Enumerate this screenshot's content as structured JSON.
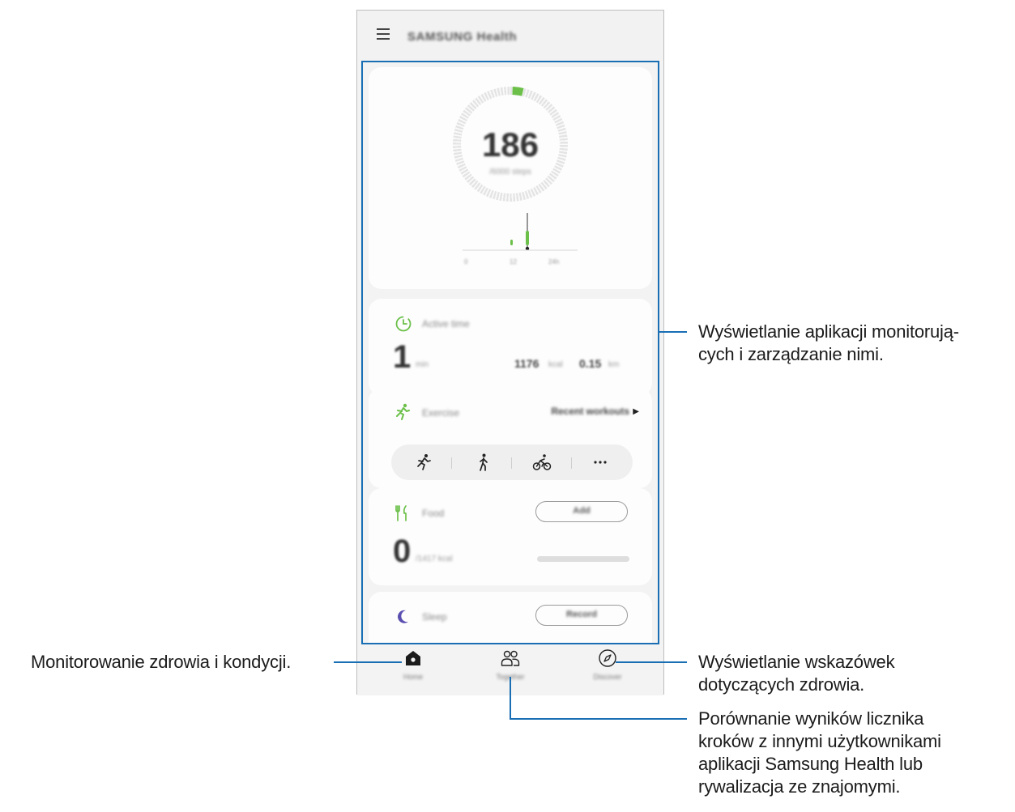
{
  "app": {
    "title": "SAMSUNG Health"
  },
  "steps_card": {
    "value": "186",
    "goal_label": "/6000 steps",
    "progress_fraction": 0.031,
    "axis_ticks": [
      "0",
      "12",
      "24h"
    ],
    "accent_color": "#6cc04a"
  },
  "active_card": {
    "title": "Active time",
    "value": "1",
    "value_unit": "min",
    "kcal_value": "1176",
    "kcal_unit": "kcal",
    "distance_value": "0.15",
    "distance_unit": "km"
  },
  "exercise_card": {
    "title": "Exercise",
    "link_label": "Recent workouts",
    "icons": [
      "running-icon",
      "walking-icon",
      "cycling-icon",
      "more-icon"
    ]
  },
  "food_card": {
    "title": "Food",
    "button_label": "Add",
    "value": "0",
    "value_unit": "/1417 kcal",
    "progress_fraction": 0.0
  },
  "sleep_card": {
    "title": "Sleep",
    "button_label": "Record"
  },
  "bottom_nav": [
    {
      "label": "Home",
      "icon": "home-icon"
    },
    {
      "label": "Together",
      "icon": "people-icon"
    },
    {
      "label": "Discover",
      "icon": "compass-icon"
    }
  ],
  "callouts": {
    "trackers": "Wyświetlanie aplikacji monitorują-\ncych i zarządzanie nimi.",
    "home": "Monitorowanie zdrowia i kondycji.",
    "discover": "Wyświetlanie wskazówek\ndotyczących zdrowia.",
    "together": "Porównanie wyników licznika\nkroków z innymi użytkownikami\naplikacji Samsung Health lub\nrywalizacja ze znajomymi."
  },
  "colors": {
    "highlight_border": "#1a6fb4",
    "accent_green": "#6cc04a",
    "sleep_moon": "#5a4fb0"
  }
}
